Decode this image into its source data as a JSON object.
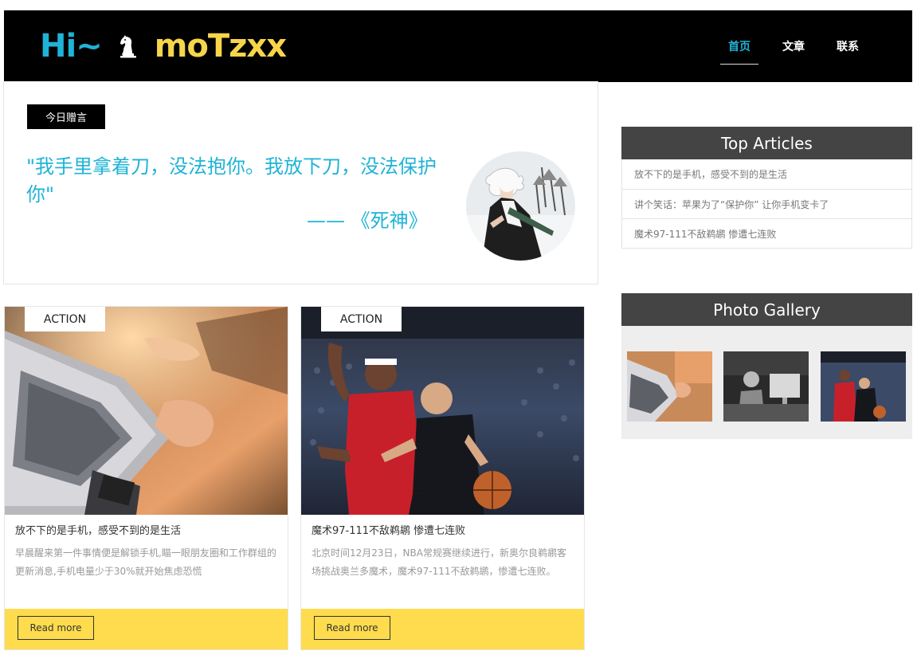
{
  "header": {
    "logo_hi": "Hi~",
    "logo_icon": "chess-knight-icon",
    "logo_name": "moTzxx",
    "nav": [
      {
        "label": "首页",
        "active": true
      },
      {
        "label": "文章",
        "active": false
      },
      {
        "label": "联系",
        "active": false
      }
    ]
  },
  "quote": {
    "badge": "今日赠言",
    "text": "\"我手里拿着刀，没法抱你。我放下刀，没法保护你\"",
    "author": "—— 《死神》"
  },
  "articles": [
    {
      "tag": "ACTION",
      "title": "放不下的是手机，感受不到的是生活",
      "desc": "早晨醒来第一件事情便是解锁手机,瞄一眼朋友圈和工作群组的更新消息,手机电量少于30%就开始焦虑恐慌",
      "button": "Read more"
    },
    {
      "tag": "ACTION",
      "title": "魔术97-111不敌鹈鹕 惨遭七连败",
      "desc": "北京时间12月23日，NBA常规赛继续进行，新奥尔良鹈鹕客场挑战奥兰多魔术，魔术97-111不敌鹈鹕，惨遭七连败。",
      "button": "Read more"
    }
  ],
  "sidebar": {
    "top_articles_title": "Top Articles",
    "top_articles": [
      "放不下的是手机，感受不到的是生活",
      "讲个笑话：苹果为了“保护你” 让你手机变卡了",
      "魔术97-111不敌鹈鹕 惨遭七连败"
    ],
    "gallery_title": "Photo Gallery"
  },
  "colors": {
    "accent": "#1fb3d6",
    "logo_name": "#f7d54a",
    "footer_yellow": "#fedc4e",
    "side_header": "#444444"
  }
}
